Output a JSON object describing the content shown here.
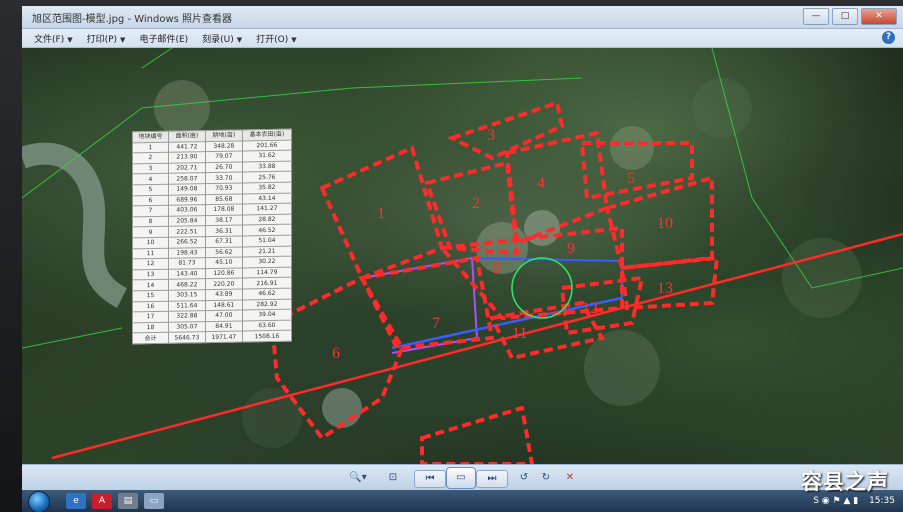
{
  "window": {
    "title": "旭区范围图-模型.jpg - Windows 照片查看器",
    "buttons": {
      "minimize": "—",
      "maximize": "□",
      "close": "✕"
    }
  },
  "menu": {
    "items": [
      {
        "label": "文件(F)",
        "has_dropdown": true
      },
      {
        "label": "打印(P)",
        "has_dropdown": true
      },
      {
        "label": "电子邮件(E)",
        "has_dropdown": false
      },
      {
        "label": "刻录(U)",
        "has_dropdown": true
      },
      {
        "label": "打开(O)",
        "has_dropdown": true
      }
    ],
    "help_label": "?"
  },
  "map": {
    "zone_labels": [
      "1",
      "2",
      "3",
      "4",
      "5",
      "6",
      "7",
      "8",
      "9",
      "10",
      "11",
      "12",
      "13"
    ],
    "colors": {
      "boundary": "#ff2a2a",
      "road_blue": "#3a5bff",
      "road_purple": "#b34cff",
      "lines_green": "#38d04a",
      "circle": "#2ee86a"
    }
  },
  "table": {
    "headers": [
      "地块编号",
      "面积(亩)",
      "耕地(亩)",
      "基本农田(亩)"
    ],
    "rows": [
      [
        "1",
        "441.72",
        "348.28",
        "201.66"
      ],
      [
        "2",
        "213.90",
        "79.07",
        "31.62"
      ],
      [
        "3",
        "202.71",
        "26.70",
        "33.88"
      ],
      [
        "4",
        "258.07",
        "33.70",
        "25.76"
      ],
      [
        "5",
        "149.08",
        "70.93",
        "35.82"
      ],
      [
        "6",
        "689.96",
        "85.68",
        "43.14"
      ],
      [
        "7",
        "403.06",
        "178.08",
        "141.27"
      ],
      [
        "8",
        "205.84",
        "38.17",
        "28.82"
      ],
      [
        "9",
        "222.51",
        "36.31",
        "46.52"
      ],
      [
        "10",
        "266.52",
        "67.31",
        "51.04"
      ],
      [
        "11",
        "198.43",
        "56.62",
        "21.21"
      ],
      [
        "12",
        "81.73",
        "45.10",
        "30.22"
      ],
      [
        "13",
        "143.40",
        "120.86",
        "114.79"
      ],
      [
        "14",
        "468.22",
        "220.20",
        "216.91"
      ],
      [
        "15",
        "303.15",
        "43.89",
        "46.62"
      ],
      [
        "16",
        "511.64",
        "148.61",
        "282.92"
      ],
      [
        "17",
        "322.88",
        "47.00",
        "39.04"
      ],
      [
        "18",
        "305.07",
        "84.91",
        "63.60"
      ],
      [
        "合计",
        "5646.73",
        "1971.47",
        "1508.16"
      ]
    ]
  },
  "viewer_toolbar": {
    "zoom": "🔍▾",
    "actual_size": "⊡",
    "prev": "⏮",
    "slideshow": "▭",
    "next": "⏭",
    "rotate_ccw": "↺",
    "rotate_cw": "↻",
    "delete": "✕"
  },
  "taskbar": {
    "apps": [
      "e",
      "A",
      "▤",
      "▭"
    ],
    "tray_icons": "S ◉ ⚑ ▲ ▮",
    "clock": "15:35"
  },
  "watermark": "容县之声"
}
